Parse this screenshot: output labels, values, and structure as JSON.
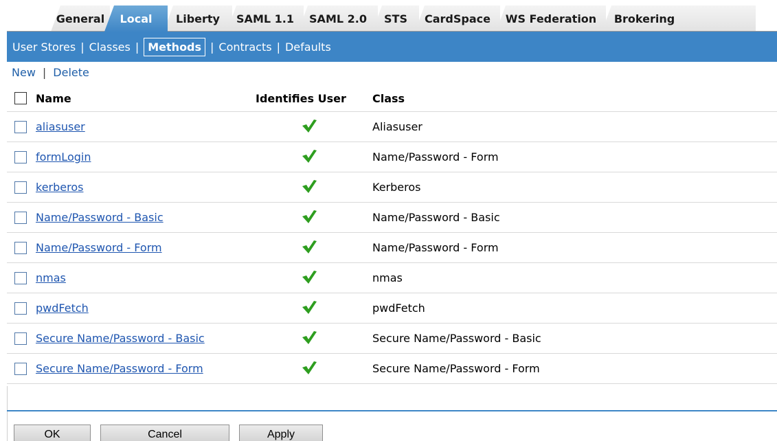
{
  "tabs": [
    {
      "label": "General",
      "active": false
    },
    {
      "label": "Local",
      "active": true
    },
    {
      "label": "Liberty",
      "active": false
    },
    {
      "label": "SAML 1.1",
      "active": false
    },
    {
      "label": "SAML 2.0",
      "active": false
    },
    {
      "label": "STS",
      "active": false
    },
    {
      "label": "CardSpace",
      "active": false
    },
    {
      "label": "WS Federation",
      "active": false
    },
    {
      "label": "Brokering",
      "active": false
    }
  ],
  "subnav": {
    "items": [
      "User Stores",
      "Classes",
      "Methods",
      "Contracts",
      "Defaults"
    ],
    "selected": "Methods",
    "separator": "|"
  },
  "actions": {
    "new_label": "New",
    "separator": "|",
    "delete_label": "Delete"
  },
  "table": {
    "headers": {
      "name": "Name",
      "identifies_user": "Identifies User",
      "class": "Class"
    },
    "rows": [
      {
        "name": "aliasuser",
        "identifies_user": true,
        "class": "Aliasuser"
      },
      {
        "name": "formLogin",
        "identifies_user": true,
        "class": "Name/Password - Form"
      },
      {
        "name": "kerberos",
        "identifies_user": true,
        "class": "Kerberos"
      },
      {
        "name": "Name/Password - Basic",
        "identifies_user": true,
        "class": "Name/Password - Basic"
      },
      {
        "name": "Name/Password - Form",
        "identifies_user": true,
        "class": "Name/Password - Form"
      },
      {
        "name": "nmas",
        "identifies_user": true,
        "class": "nmas"
      },
      {
        "name": "pwdFetch",
        "identifies_user": true,
        "class": "pwdFetch"
      },
      {
        "name": "Secure Name/Password - Basic",
        "identifies_user": true,
        "class": "Secure Name/Password - Basic"
      },
      {
        "name": "Secure Name/Password - Form",
        "identifies_user": true,
        "class": "Secure Name/Password - Form"
      }
    ]
  },
  "buttons": {
    "ok": "OK",
    "cancel": "Cancel",
    "apply": "Apply"
  },
  "colors": {
    "accent": "#3d85c6",
    "link": "#1f56b0",
    "check": "#2e9e1f"
  },
  "icons": {
    "identifies_user": "checkmark-icon"
  }
}
